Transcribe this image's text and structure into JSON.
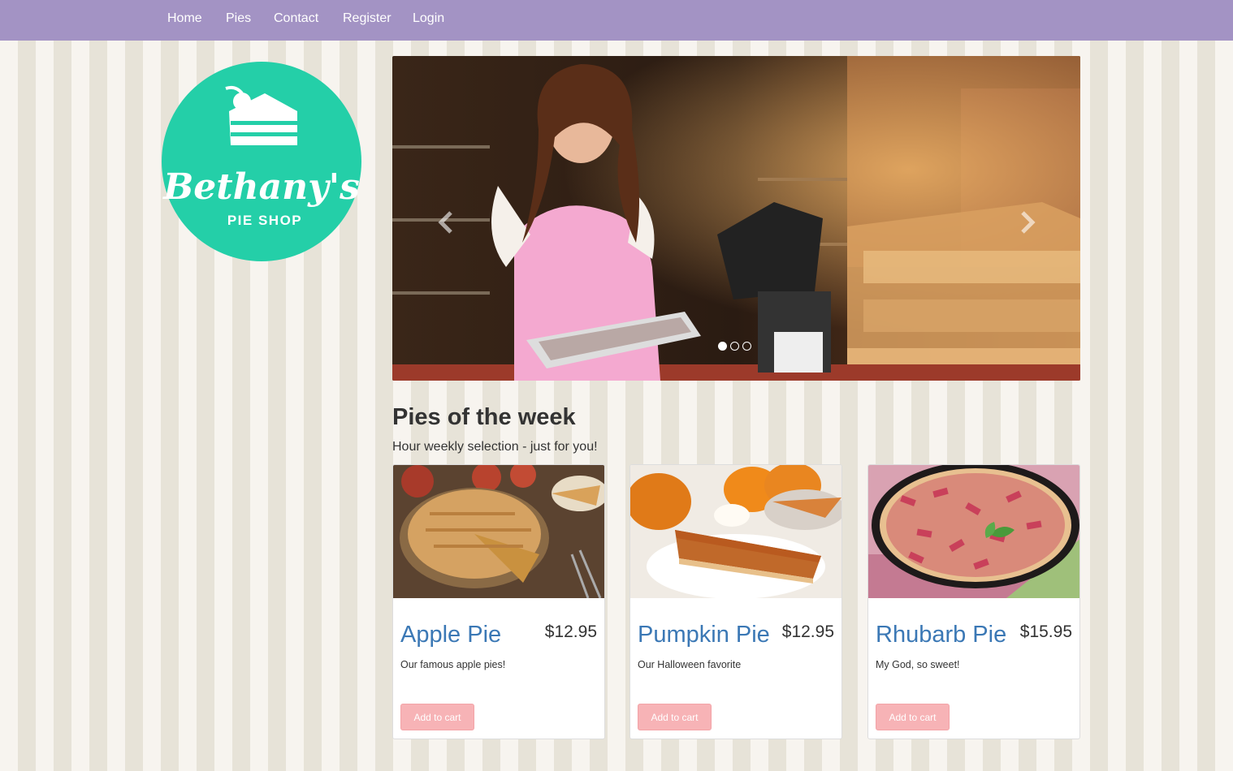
{
  "nav": {
    "items": [
      {
        "label": "Home"
      },
      {
        "label": "Pies"
      },
      {
        "label": "Contact"
      },
      {
        "label": "Register"
      },
      {
        "label": "Login"
      }
    ]
  },
  "logo": {
    "line1": "Bethany's",
    "line2": "PIE SHOP",
    "color": "#24cfa8"
  },
  "carousel": {
    "slide_count": 3,
    "active_index": 0
  },
  "section": {
    "title": "Pies of the week",
    "subtitle": "Hour weekly selection - just for you!"
  },
  "pies": [
    {
      "name": "Apple Pie",
      "price": "$12.95",
      "description": "Our famous apple pies!",
      "button": "Add to cart"
    },
    {
      "name": "Pumpkin Pie",
      "price": "$12.95",
      "description": "Our Halloween favorite",
      "button": "Add to cart"
    },
    {
      "name": "Rhubarb Pie",
      "price": "$15.95",
      "description": "My God, so sweet!",
      "button": "Add to cart"
    }
  ],
  "colors": {
    "navbar": "#a393c4",
    "link": "#3b78b5",
    "button": "#f7b3b6"
  }
}
